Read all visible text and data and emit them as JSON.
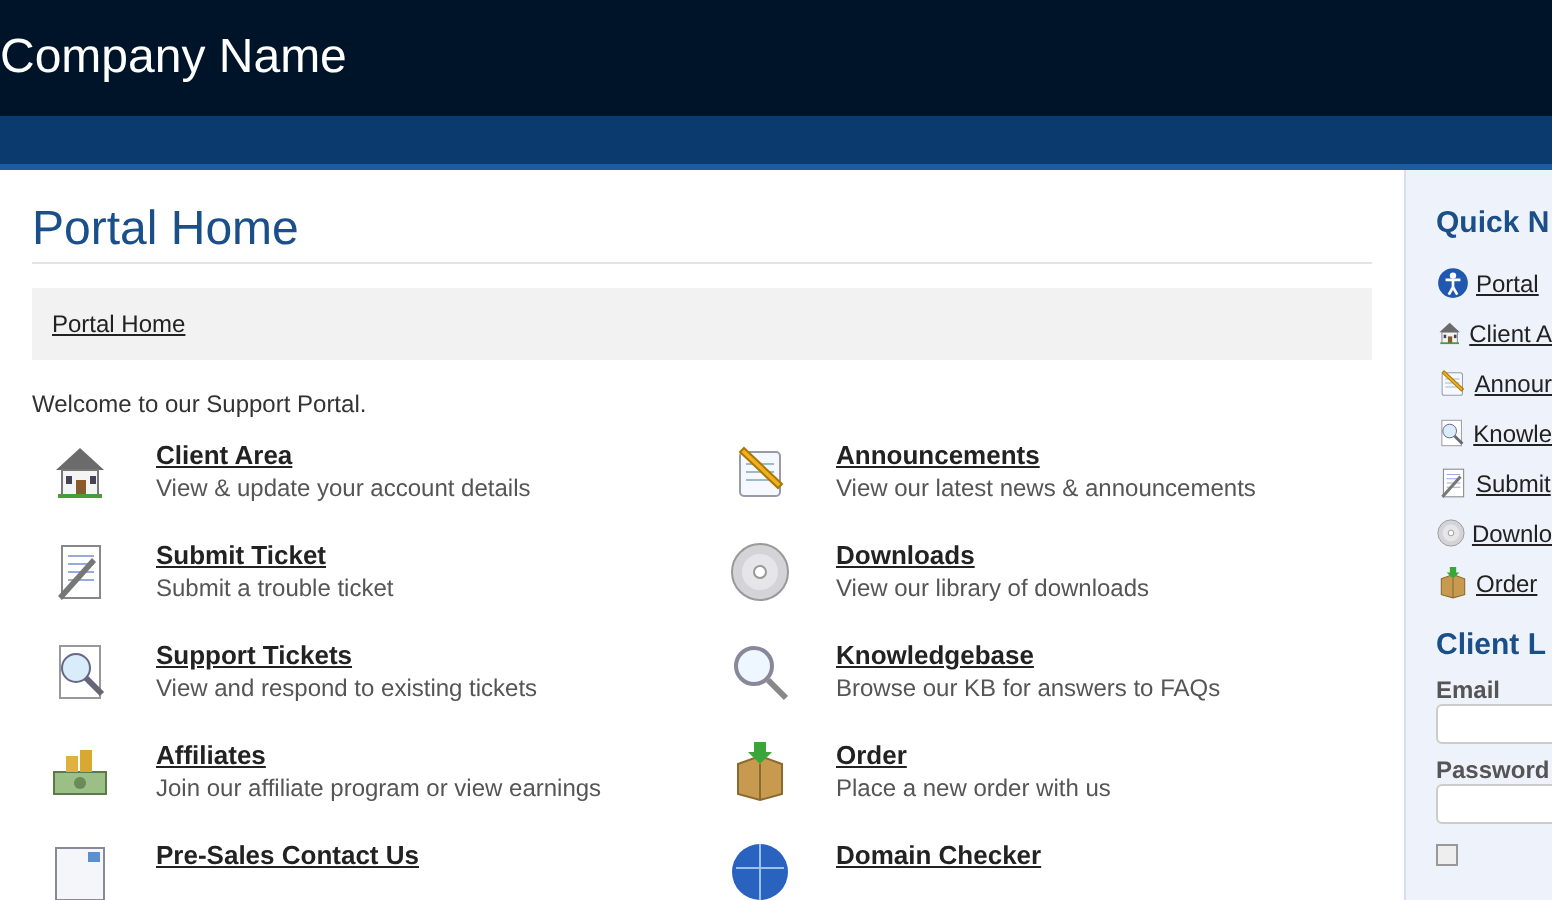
{
  "header": {
    "company_name": "Company Name"
  },
  "page_title": "Portal Home",
  "breadcrumb": [
    "Portal Home"
  ],
  "welcome": "Welcome to our Support Portal.",
  "links": [
    {
      "kind": "house",
      "title": "Client Area",
      "description": "View & update your account details"
    },
    {
      "kind": "note",
      "title": "Announcements",
      "description": "View our latest news & announcements"
    },
    {
      "kind": "ticket",
      "title": "Submit Ticket",
      "description": "Submit a trouble ticket"
    },
    {
      "kind": "disc",
      "title": "Downloads",
      "description": "View our library of downloads"
    },
    {
      "kind": "search",
      "title": "Support Tickets",
      "description": "View and respond to existing tickets"
    },
    {
      "kind": "magnifier",
      "title": "Knowledgebase",
      "description": "Browse our KB for answers to FAQs"
    },
    {
      "kind": "money",
      "title": "Affiliates",
      "description": "Join our affiliate program or view earnings"
    },
    {
      "kind": "box",
      "title": "Order",
      "description": "Place a new order with us"
    },
    {
      "kind": "contact",
      "title": "Pre-Sales Contact Us"
    },
    {
      "kind": "globe",
      "title": "Domain Checker"
    }
  ],
  "sidebar": {
    "quick_nav_title": "Quick N",
    "quick_nav": [
      {
        "kind": "portal",
        "label": "Portal"
      },
      {
        "kind": "house",
        "label": "Client A"
      },
      {
        "kind": "note",
        "label": "Annour"
      },
      {
        "kind": "search",
        "label": "Knowle"
      },
      {
        "kind": "ticket",
        "label": "Submit"
      },
      {
        "kind": "disc",
        "label": "Downlo"
      },
      {
        "kind": "box",
        "label": "Order"
      }
    ],
    "login_title": "Client L",
    "fields": [
      {
        "label": "Email"
      },
      {
        "label": "Password"
      }
    ],
    "remember": {
      "checked": false
    }
  }
}
